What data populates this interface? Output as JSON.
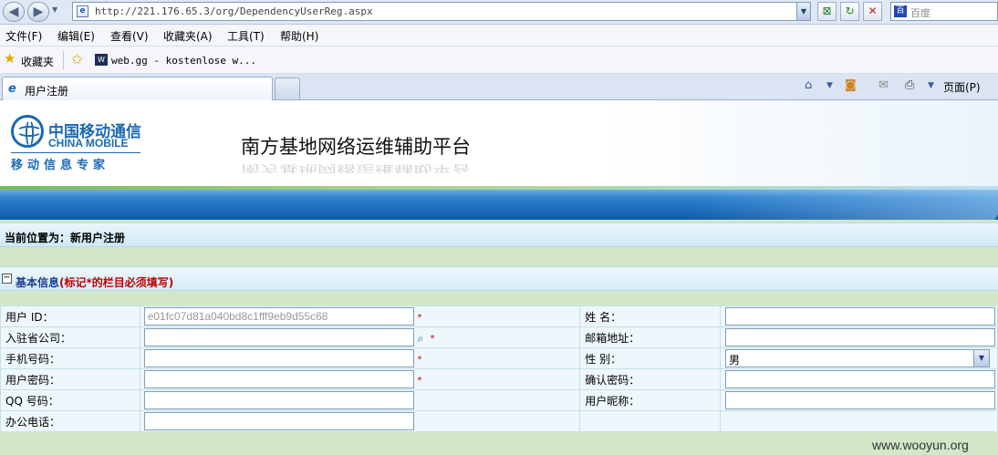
{
  "browser": {
    "url": "http://221.176.65.3/org/DependencyUserReg.aspx",
    "search_provider": "百度",
    "menu": [
      "文件(F)",
      "编辑(E)",
      "查看(V)",
      "收藏夹(A)",
      "工具(T)",
      "帮助(H)"
    ],
    "favorites_label": "收藏夹",
    "favorite_link": "web.gg - kostenlose w...",
    "tab_title": "用户注册",
    "page_menu": "页面(P)"
  },
  "header": {
    "logo_cn": "中国移动通信",
    "logo_en": "CHINA MOBILE",
    "logo_sub": "移动信息专家",
    "site_title": "南方基地网络运维辅助平台"
  },
  "breadcrumb": "当前位置为：新用户注册",
  "section": {
    "title": "基本信息",
    "note": "(标记*的栏目必须填写)"
  },
  "form": {
    "user_id_label": "用户 ID：",
    "user_id_value": "e01fc07d81a040bd8c1fff9eb9d55c68",
    "company_label": "入驻省公司：",
    "mobile_label": "手机号码：",
    "password_label": "用户密码：",
    "qq_label": "QQ 号码：",
    "office_phone_label": "办公电话：",
    "name_label": "姓 名：",
    "email_label": "邮箱地址：",
    "gender_label": "性 别：",
    "gender_value": "男",
    "confirm_password_label": "确认密码：",
    "nickname_label": "用户昵称：",
    "required_mark": "*"
  },
  "watermark": "www.wooyun.org",
  "colors": {
    "brand_blue": "#1b6ab3",
    "required_red": "#c00000",
    "content_green": "#d1e7c8"
  }
}
